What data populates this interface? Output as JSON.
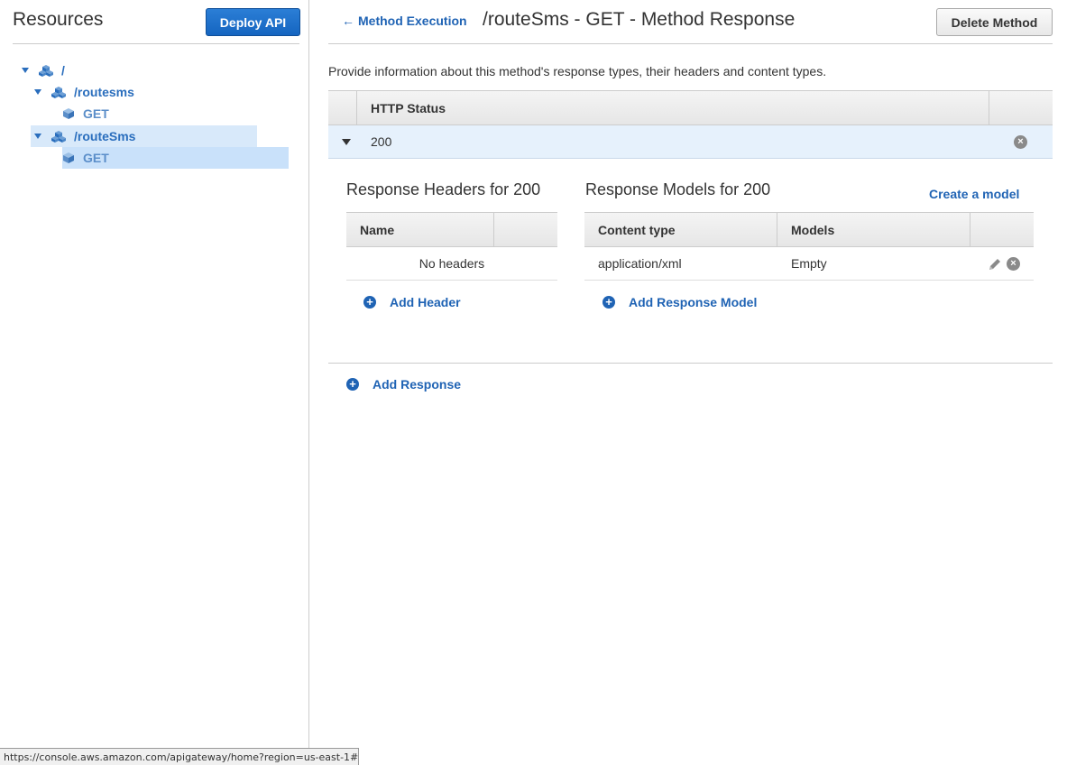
{
  "sidebar": {
    "title": "Resources",
    "deploy_label": "Deploy API",
    "tree": {
      "root": "/",
      "routesms": "/routesms",
      "routesms_get": "GET",
      "routeSms": "/routeSms",
      "routeSms_get": "GET"
    }
  },
  "header": {
    "back_label": "Method Execution",
    "back_arrow": "←",
    "title": "/routeSms - GET - Method Response",
    "delete_label": "Delete Method"
  },
  "description": "Provide information about this method's response types, their headers and content types.",
  "status_table": {
    "header": "HTTP Status",
    "rows": [
      {
        "code": "200"
      }
    ]
  },
  "response_headers": {
    "title": "Response Headers for 200",
    "column": "Name",
    "empty_text": "No headers",
    "add_label": "Add Header"
  },
  "response_models": {
    "title": "Response Models for 200",
    "create_label": "Create a model",
    "columns": [
      "Content type",
      "Models"
    ],
    "rows": [
      {
        "content_type": "application/xml",
        "model": "Empty"
      }
    ],
    "add_label": "Add Response Model"
  },
  "add_response_label": "Add Response",
  "statusbar_url": "https://console.aws.amazon.com/apigateway/home?region=us-east-1#/...",
  "icons": {
    "remove": "×",
    "add": "+"
  },
  "colors": {
    "link": "#1f63b4",
    "deploy_button": "#1565c0",
    "selected_row": "#e6f1fc"
  }
}
